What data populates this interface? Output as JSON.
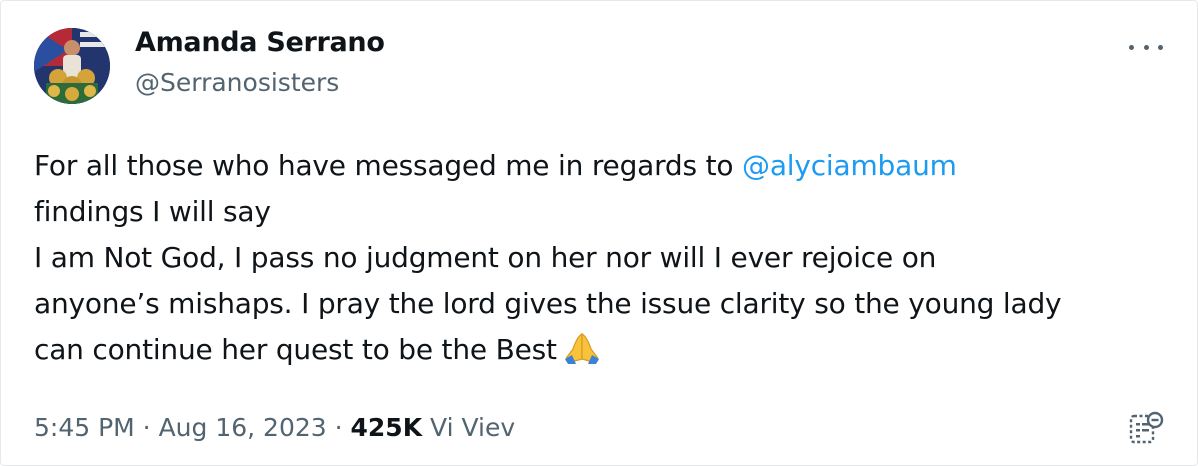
{
  "author": {
    "name": "Amanda Serrano",
    "handle": "@Serranosisters",
    "avatar_icon": "profile-avatar"
  },
  "more_icon": "more-options-icon",
  "tweet": {
    "line1_text": "For all those who have messaged me in regards to ",
    "line1_mention": "@alyciambaum",
    "line2": "findings I will say",
    "line3": "I am Not God, I pass no judgment on her nor will I ever rejoice on",
    "line4": "anyone’s mishaps. I pray the lord gives the issue clarity so the young lady",
    "line5": "can continue her quest to be the Best",
    "emoji": "folded-hands-emoji"
  },
  "meta": {
    "time": "5:45 PM",
    "separator": " · ",
    "date": "Aug 16, 2023",
    "views_count": "425K",
    "views_label": "Vi Viev"
  },
  "notes_icon": "community-notes-icon",
  "colors": {
    "text": "#0f1419",
    "secondary": "#536471",
    "link": "#1d9bf0"
  }
}
